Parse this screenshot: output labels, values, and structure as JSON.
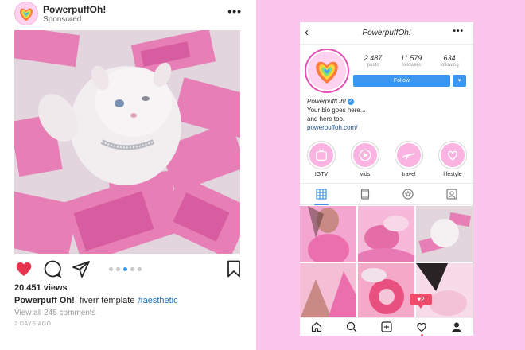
{
  "post": {
    "username": "PowerpuffOh!",
    "sponsored_label": "Sponsored",
    "more_label": "•••",
    "views": "20.451 views",
    "caption_user": "Powerpuff Oh!",
    "caption_text": "fiverr template",
    "caption_hashtag": "#aesthetic",
    "comments_label": "View all 245 comments",
    "time_ago": "2 DAYS AGO",
    "carousel": {
      "count": 5,
      "active_index": 3
    },
    "icons": [
      "heart-icon",
      "comment-icon",
      "share-icon",
      "bookmark-icon"
    ]
  },
  "profile": {
    "back_label": "‹",
    "title": "PowerpuffOh!",
    "more_label": "•••",
    "stats": [
      {
        "value": "2.487",
        "label": "posts"
      },
      {
        "value": "11.579",
        "label": "followers"
      },
      {
        "value": "634",
        "label": "following"
      }
    ],
    "follow_label": "Follow",
    "dropdown_label": "▾",
    "bio_name": "PowerpuffOh!",
    "bio_line1": "Your bio goes here...",
    "bio_line2": "and here too.",
    "bio_link": "powerpuffoh.com/",
    "highlights": [
      {
        "label": "IGTV",
        "icon": "tv-icon"
      },
      {
        "label": "vids",
        "icon": "play-icon"
      },
      {
        "label": "travel",
        "icon": "airplane-icon"
      },
      {
        "label": "lifestyle",
        "icon": "heart-outline-icon"
      }
    ],
    "tabs": [
      "grid-icon",
      "tablet-icon",
      "star-icon",
      "tagged-icon"
    ],
    "like_notification": "2",
    "bottom_nav": [
      "home-icon",
      "search-icon",
      "add-icon",
      "heart-icon",
      "profile-icon"
    ]
  },
  "colors": {
    "accent_blue": "#3a96ee",
    "pink_background": "#fcc6ec",
    "like_red": "#e8344f",
    "notification": "#ef4b6b"
  }
}
